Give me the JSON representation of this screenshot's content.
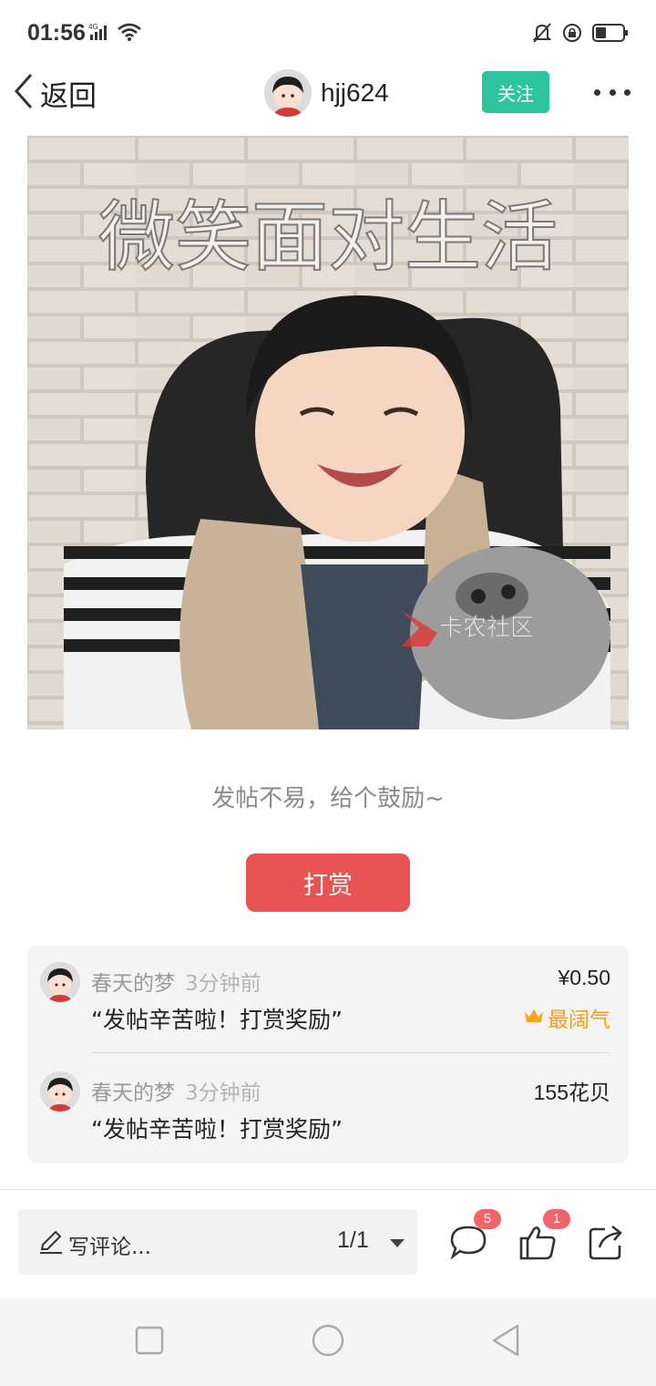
{
  "status_bar": {
    "time": "01:56",
    "network": "4G"
  },
  "header": {
    "back_label": "返回",
    "author_name": "hjj624",
    "follow_label": "关注"
  },
  "post": {
    "image_caption": "微笑面对生活",
    "watermark": "卡农社区"
  },
  "reward": {
    "encourage_text": "发帖不易，给个鼓励~",
    "tip_button_label": "打赏",
    "items": [
      {
        "user": "春天的梦",
        "time": "3分钟前",
        "message": "“发帖辛苦啦！打赏奖励”",
        "amount": "¥0.50",
        "badge": "最阔气"
      },
      {
        "user": "春天的梦",
        "time": "3分钟前",
        "message": "“发帖辛苦啦！打赏奖励”",
        "amount": "155花贝"
      }
    ]
  },
  "bottom_bar": {
    "comment_placeholder": "写评论...",
    "page_indicator": "1/1",
    "comment_count": "5",
    "like_count": "1"
  },
  "colors": {
    "follow_green": "#2ec4a0",
    "tip_red": "#e85454",
    "badge_gold": "#f0a020",
    "count_badge": "#f0646a"
  }
}
